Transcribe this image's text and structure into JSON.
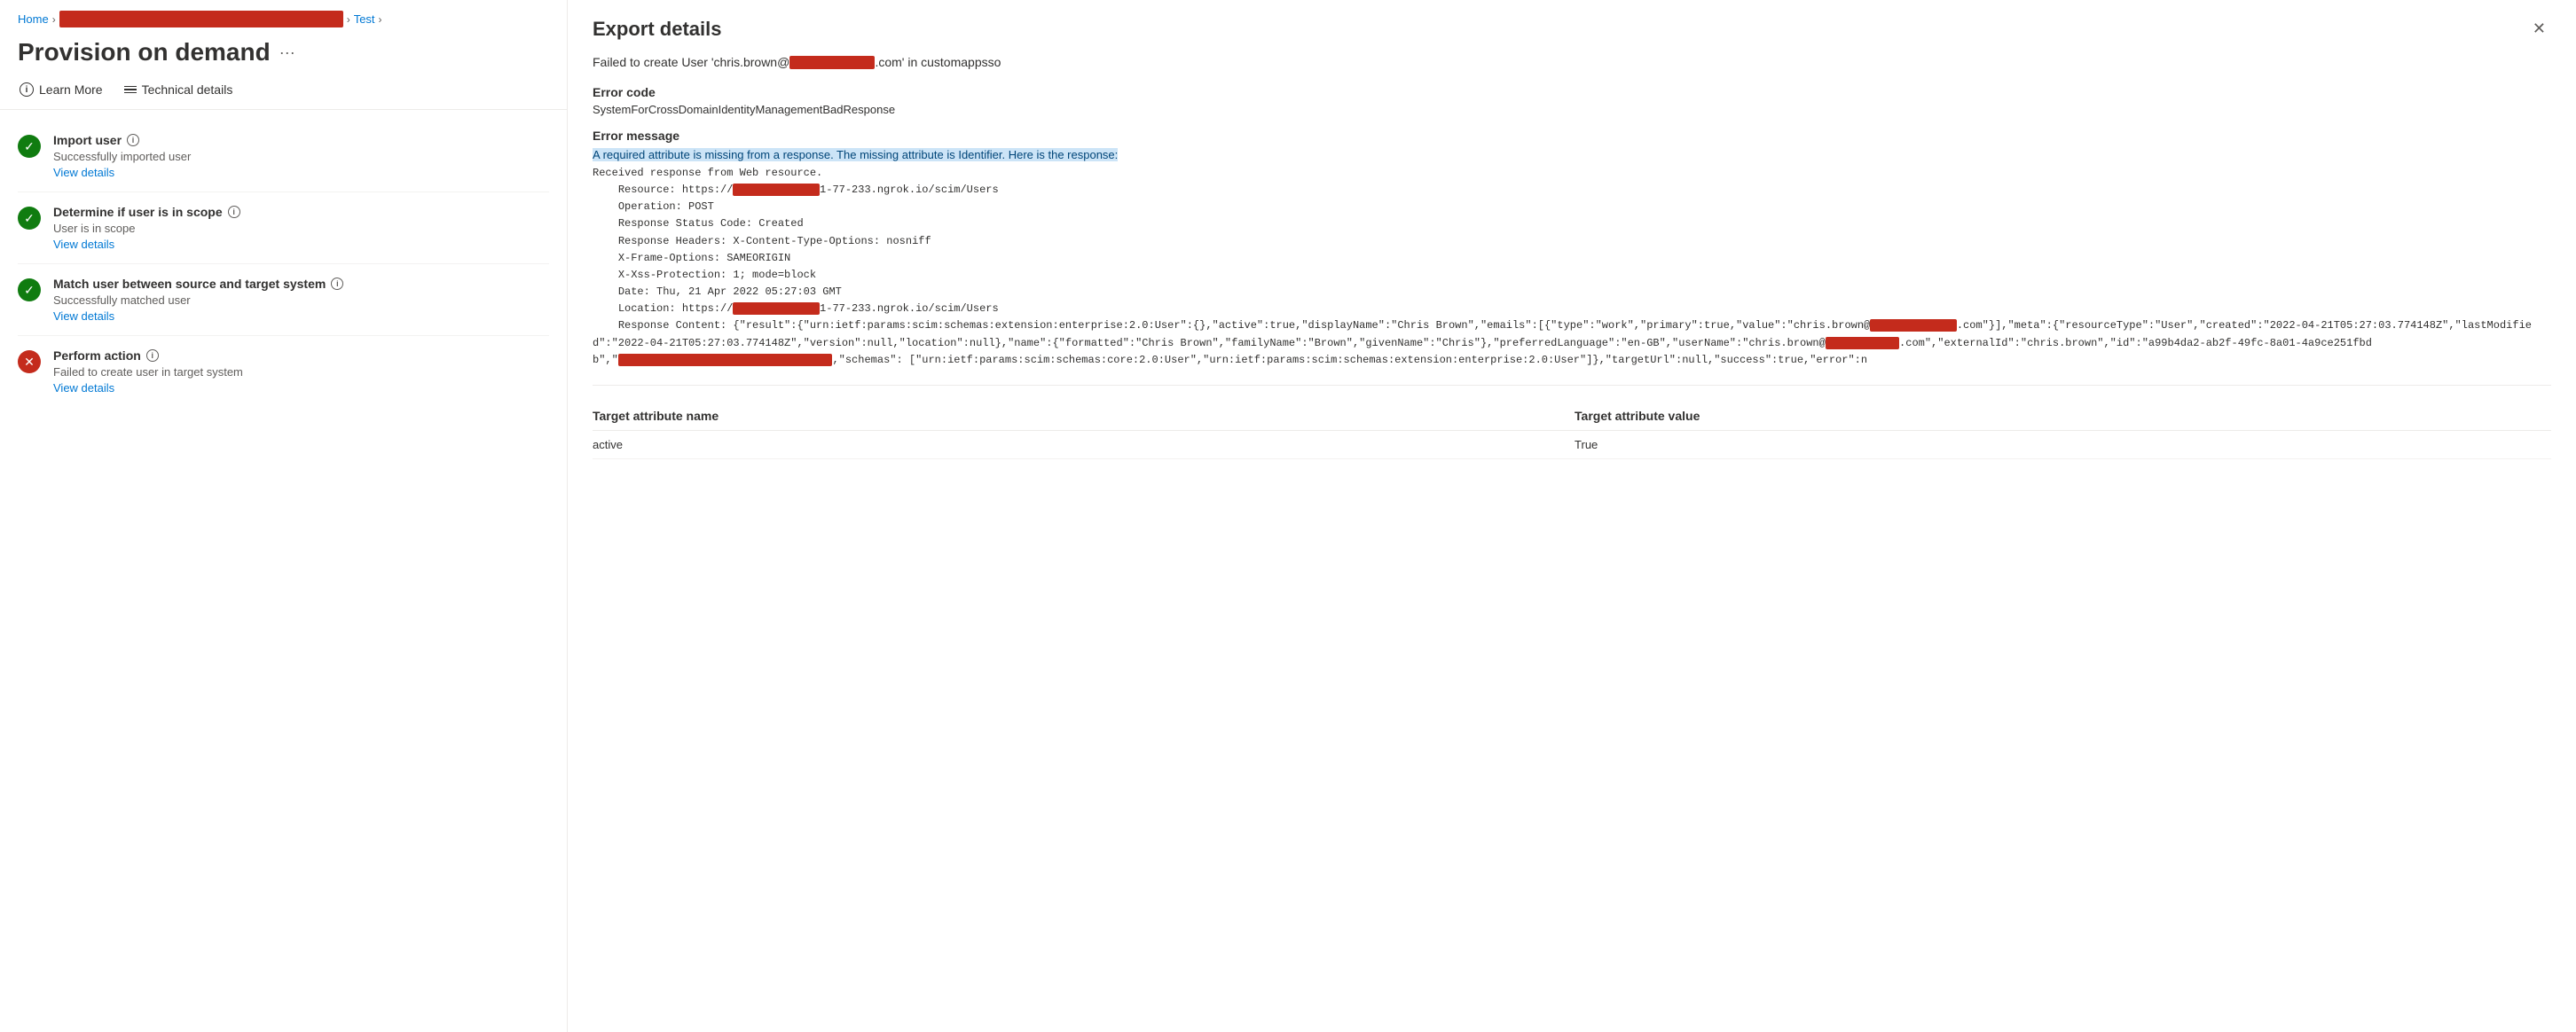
{
  "breadcrumb": {
    "home": "Home",
    "redacted": "",
    "test": "Test"
  },
  "page": {
    "title": "Provision on demand",
    "ellipsis": "···"
  },
  "toolbar": {
    "learn_more": "Learn More",
    "technical_details": "Technical details"
  },
  "steps": [
    {
      "id": "import-user",
      "status": "success",
      "title": "Import user",
      "description": "Successfully imported user",
      "link": "View details"
    },
    {
      "id": "determine-scope",
      "status": "success",
      "title": "Determine if user is in scope",
      "description": "User is in scope",
      "link": "View details"
    },
    {
      "id": "match-user",
      "status": "success",
      "title": "Match user between source and target system",
      "description": "Successfully matched user",
      "link": "View details"
    },
    {
      "id": "perform-action",
      "status": "error",
      "title": "Perform action",
      "description": "Failed to create user in target system",
      "link": "View details"
    }
  ],
  "export_panel": {
    "title": "Export details",
    "error_summary_prefix": "Failed to create User 'chris.brown@",
    "error_summary_suffix": ".com' in customappsso",
    "error_code_label": "Error code",
    "error_code_value": "SystemForCrossDomainIdentityManagementBadResponse",
    "error_message_label": "Error message",
    "error_message_highlight": "A required attribute is missing from a response.  The missing attribute is Identifier.  Here is the response:",
    "error_message_body": "Received response from Web resource.\n    Resource: https://",
    "resource_suffix": "1-77-233.ngrok.io/scim/Users",
    "operation": "    Operation: POST",
    "status_code": "    Response Status Code: Created",
    "response_headers": "    Response Headers: X-Content-Type-Options: nosniff",
    "x_frame": "    X-Frame-Options: SAMEORIGIN",
    "x_xss": "    X-Xss-Protection: 1; mode=block",
    "date": "    Date: Thu, 21 Apr 2022 05:27:03 GMT",
    "location_prefix": "    Location: https://",
    "location_suffix": "1-77-233.ngrok.io/scim/Users",
    "response_content_label": "    Response Content: {\"result\":{\"urn:ietf:params:scim:schemas:extension:enterprise:2.0:User\":{},\"active\":true,\"displayName\":\"Chris Brown\",\"emails\":[{\"type\":\"work\",\"primary\":true,\"value\":\"chris.brown@",
    "response_content_mid": ".com\"}],\"meta\":{\"resourceType\":\"User\",\"created\":\"2022-04-21T05:27:03.774148Z\",\"lastModified\":\"2022-04-21T05:27:03.774148Z\",\"version\":null,\"location\":null},\"name\":{\"formatted\":\"Chris Brown\",\"familyName\":\"Brown\",\"givenName\":\"Chris\"},\"preferredLanguage\":\"en-GB\",\"userName\":\"chris.brown@",
    "response_content_end": ".com\",\"externalId\":\"chris.brown\",\"id\":\"a99b4da2-ab2f-49fc-8a01-4a9ce251fbdb\",\"",
    "response_content_schemas": ",\"schemas\": [\"urn:ietf:params:scim:schemas:core:2.0:User\",\"urn:ietf:params:scim:schemas:extension:enterprise:2.0:User\"]},\"targetUrl\":null,\"success\":true,\"error\":n",
    "table": {
      "col1": "Target attribute name",
      "col2": "Target attribute value",
      "rows": [
        {
          "name": "active",
          "value": "True"
        }
      ]
    }
  },
  "colors": {
    "success": "#107c10",
    "error": "#c42b1c",
    "link": "#0078d4",
    "redacted": "#c42b1c"
  }
}
